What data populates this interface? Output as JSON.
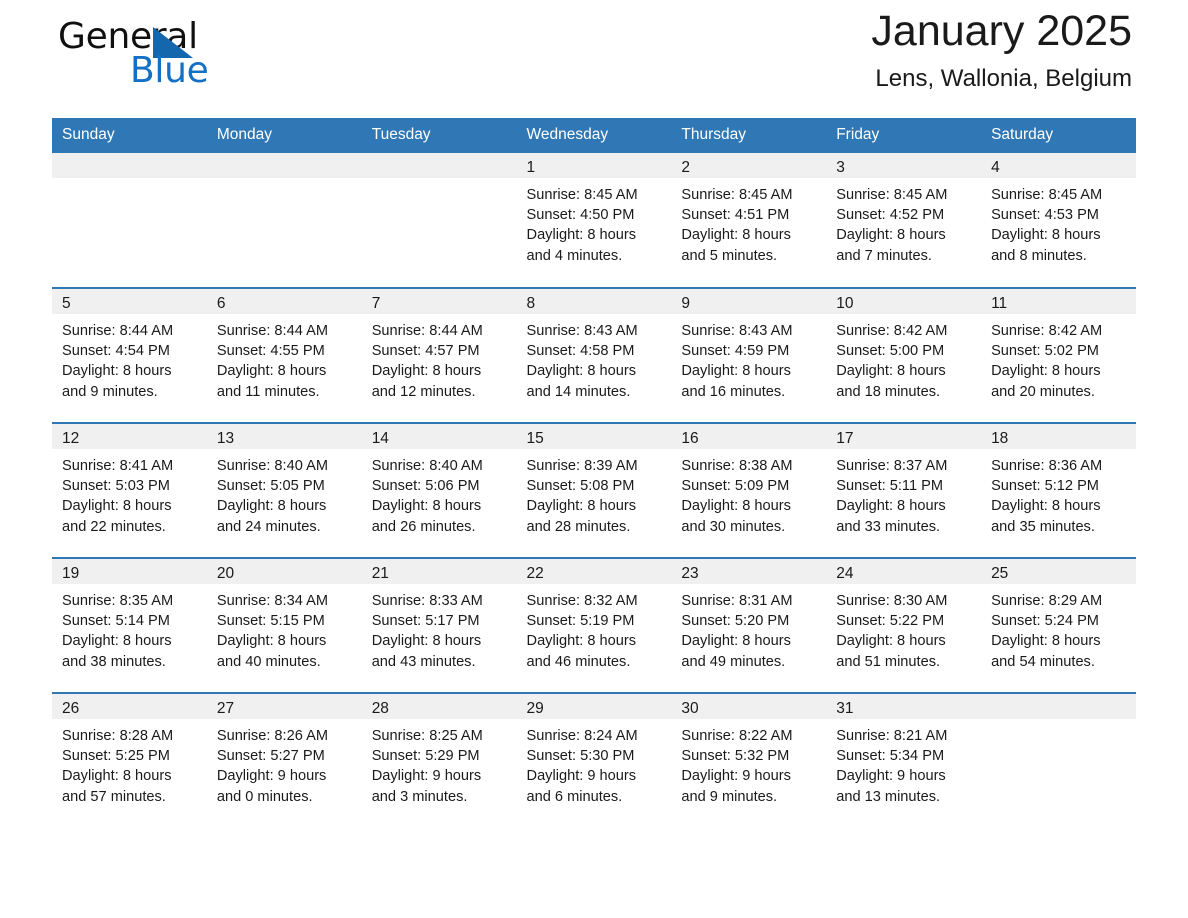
{
  "brand": {
    "name_part1": "General",
    "name_part2": "Blue",
    "triangle_color": "#1567ad",
    "blue_text_color": "#1370c4"
  },
  "header": {
    "title": "January 2025",
    "subtitle": "Lens, Wallonia, Belgium"
  },
  "theme": {
    "header_bg": "#2f78b5",
    "row_divider": "#2f78b5",
    "daynum_band_bg": "#f0f0f0",
    "page_bg": "#ffffff",
    "text": "#1a1a1a"
  },
  "calendar": {
    "weekday_headers": [
      "Sunday",
      "Monday",
      "Tuesday",
      "Wednesday",
      "Thursday",
      "Friday",
      "Saturday"
    ],
    "weeks": [
      [
        {
          "day": "",
          "lines": []
        },
        {
          "day": "",
          "lines": []
        },
        {
          "day": "",
          "lines": []
        },
        {
          "day": "1",
          "lines": [
            "Sunrise: 8:45 AM",
            "Sunset: 4:50 PM",
            "Daylight: 8 hours",
            "and 4 minutes."
          ]
        },
        {
          "day": "2",
          "lines": [
            "Sunrise: 8:45 AM",
            "Sunset: 4:51 PM",
            "Daylight: 8 hours",
            "and 5 minutes."
          ]
        },
        {
          "day": "3",
          "lines": [
            "Sunrise: 8:45 AM",
            "Sunset: 4:52 PM",
            "Daylight: 8 hours",
            "and 7 minutes."
          ]
        },
        {
          "day": "4",
          "lines": [
            "Sunrise: 8:45 AM",
            "Sunset: 4:53 PM",
            "Daylight: 8 hours",
            "and 8 minutes."
          ]
        }
      ],
      [
        {
          "day": "5",
          "lines": [
            "Sunrise: 8:44 AM",
            "Sunset: 4:54 PM",
            "Daylight: 8 hours",
            "and 9 minutes."
          ]
        },
        {
          "day": "6",
          "lines": [
            "Sunrise: 8:44 AM",
            "Sunset: 4:55 PM",
            "Daylight: 8 hours",
            "and 11 minutes."
          ]
        },
        {
          "day": "7",
          "lines": [
            "Sunrise: 8:44 AM",
            "Sunset: 4:57 PM",
            "Daylight: 8 hours",
            "and 12 minutes."
          ]
        },
        {
          "day": "8",
          "lines": [
            "Sunrise: 8:43 AM",
            "Sunset: 4:58 PM",
            "Daylight: 8 hours",
            "and 14 minutes."
          ]
        },
        {
          "day": "9",
          "lines": [
            "Sunrise: 8:43 AM",
            "Sunset: 4:59 PM",
            "Daylight: 8 hours",
            "and 16 minutes."
          ]
        },
        {
          "day": "10",
          "lines": [
            "Sunrise: 8:42 AM",
            "Sunset: 5:00 PM",
            "Daylight: 8 hours",
            "and 18 minutes."
          ]
        },
        {
          "day": "11",
          "lines": [
            "Sunrise: 8:42 AM",
            "Sunset: 5:02 PM",
            "Daylight: 8 hours",
            "and 20 minutes."
          ]
        }
      ],
      [
        {
          "day": "12",
          "lines": [
            "Sunrise: 8:41 AM",
            "Sunset: 5:03 PM",
            "Daylight: 8 hours",
            "and 22 minutes."
          ]
        },
        {
          "day": "13",
          "lines": [
            "Sunrise: 8:40 AM",
            "Sunset: 5:05 PM",
            "Daylight: 8 hours",
            "and 24 minutes."
          ]
        },
        {
          "day": "14",
          "lines": [
            "Sunrise: 8:40 AM",
            "Sunset: 5:06 PM",
            "Daylight: 8 hours",
            "and 26 minutes."
          ]
        },
        {
          "day": "15",
          "lines": [
            "Sunrise: 8:39 AM",
            "Sunset: 5:08 PM",
            "Daylight: 8 hours",
            "and 28 minutes."
          ]
        },
        {
          "day": "16",
          "lines": [
            "Sunrise: 8:38 AM",
            "Sunset: 5:09 PM",
            "Daylight: 8 hours",
            "and 30 minutes."
          ]
        },
        {
          "day": "17",
          "lines": [
            "Sunrise: 8:37 AM",
            "Sunset: 5:11 PM",
            "Daylight: 8 hours",
            "and 33 minutes."
          ]
        },
        {
          "day": "18",
          "lines": [
            "Sunrise: 8:36 AM",
            "Sunset: 5:12 PM",
            "Daylight: 8 hours",
            "and 35 minutes."
          ]
        }
      ],
      [
        {
          "day": "19",
          "lines": [
            "Sunrise: 8:35 AM",
            "Sunset: 5:14 PM",
            "Daylight: 8 hours",
            "and 38 minutes."
          ]
        },
        {
          "day": "20",
          "lines": [
            "Sunrise: 8:34 AM",
            "Sunset: 5:15 PM",
            "Daylight: 8 hours",
            "and 40 minutes."
          ]
        },
        {
          "day": "21",
          "lines": [
            "Sunrise: 8:33 AM",
            "Sunset: 5:17 PM",
            "Daylight: 8 hours",
            "and 43 minutes."
          ]
        },
        {
          "day": "22",
          "lines": [
            "Sunrise: 8:32 AM",
            "Sunset: 5:19 PM",
            "Daylight: 8 hours",
            "and 46 minutes."
          ]
        },
        {
          "day": "23",
          "lines": [
            "Sunrise: 8:31 AM",
            "Sunset: 5:20 PM",
            "Daylight: 8 hours",
            "and 49 minutes."
          ]
        },
        {
          "day": "24",
          "lines": [
            "Sunrise: 8:30 AM",
            "Sunset: 5:22 PM",
            "Daylight: 8 hours",
            "and 51 minutes."
          ]
        },
        {
          "day": "25",
          "lines": [
            "Sunrise: 8:29 AM",
            "Sunset: 5:24 PM",
            "Daylight: 8 hours",
            "and 54 minutes."
          ]
        }
      ],
      [
        {
          "day": "26",
          "lines": [
            "Sunrise: 8:28 AM",
            "Sunset: 5:25 PM",
            "Daylight: 8 hours",
            "and 57 minutes."
          ]
        },
        {
          "day": "27",
          "lines": [
            "Sunrise: 8:26 AM",
            "Sunset: 5:27 PM",
            "Daylight: 9 hours",
            "and 0 minutes."
          ]
        },
        {
          "day": "28",
          "lines": [
            "Sunrise: 8:25 AM",
            "Sunset: 5:29 PM",
            "Daylight: 9 hours",
            "and 3 minutes."
          ]
        },
        {
          "day": "29",
          "lines": [
            "Sunrise: 8:24 AM",
            "Sunset: 5:30 PM",
            "Daylight: 9 hours",
            "and 6 minutes."
          ]
        },
        {
          "day": "30",
          "lines": [
            "Sunrise: 8:22 AM",
            "Sunset: 5:32 PM",
            "Daylight: 9 hours",
            "and 9 minutes."
          ]
        },
        {
          "day": "31",
          "lines": [
            "Sunrise: 8:21 AM",
            "Sunset: 5:34 PM",
            "Daylight: 9 hours",
            "and 13 minutes."
          ]
        },
        {
          "day": "",
          "lines": []
        }
      ]
    ]
  }
}
